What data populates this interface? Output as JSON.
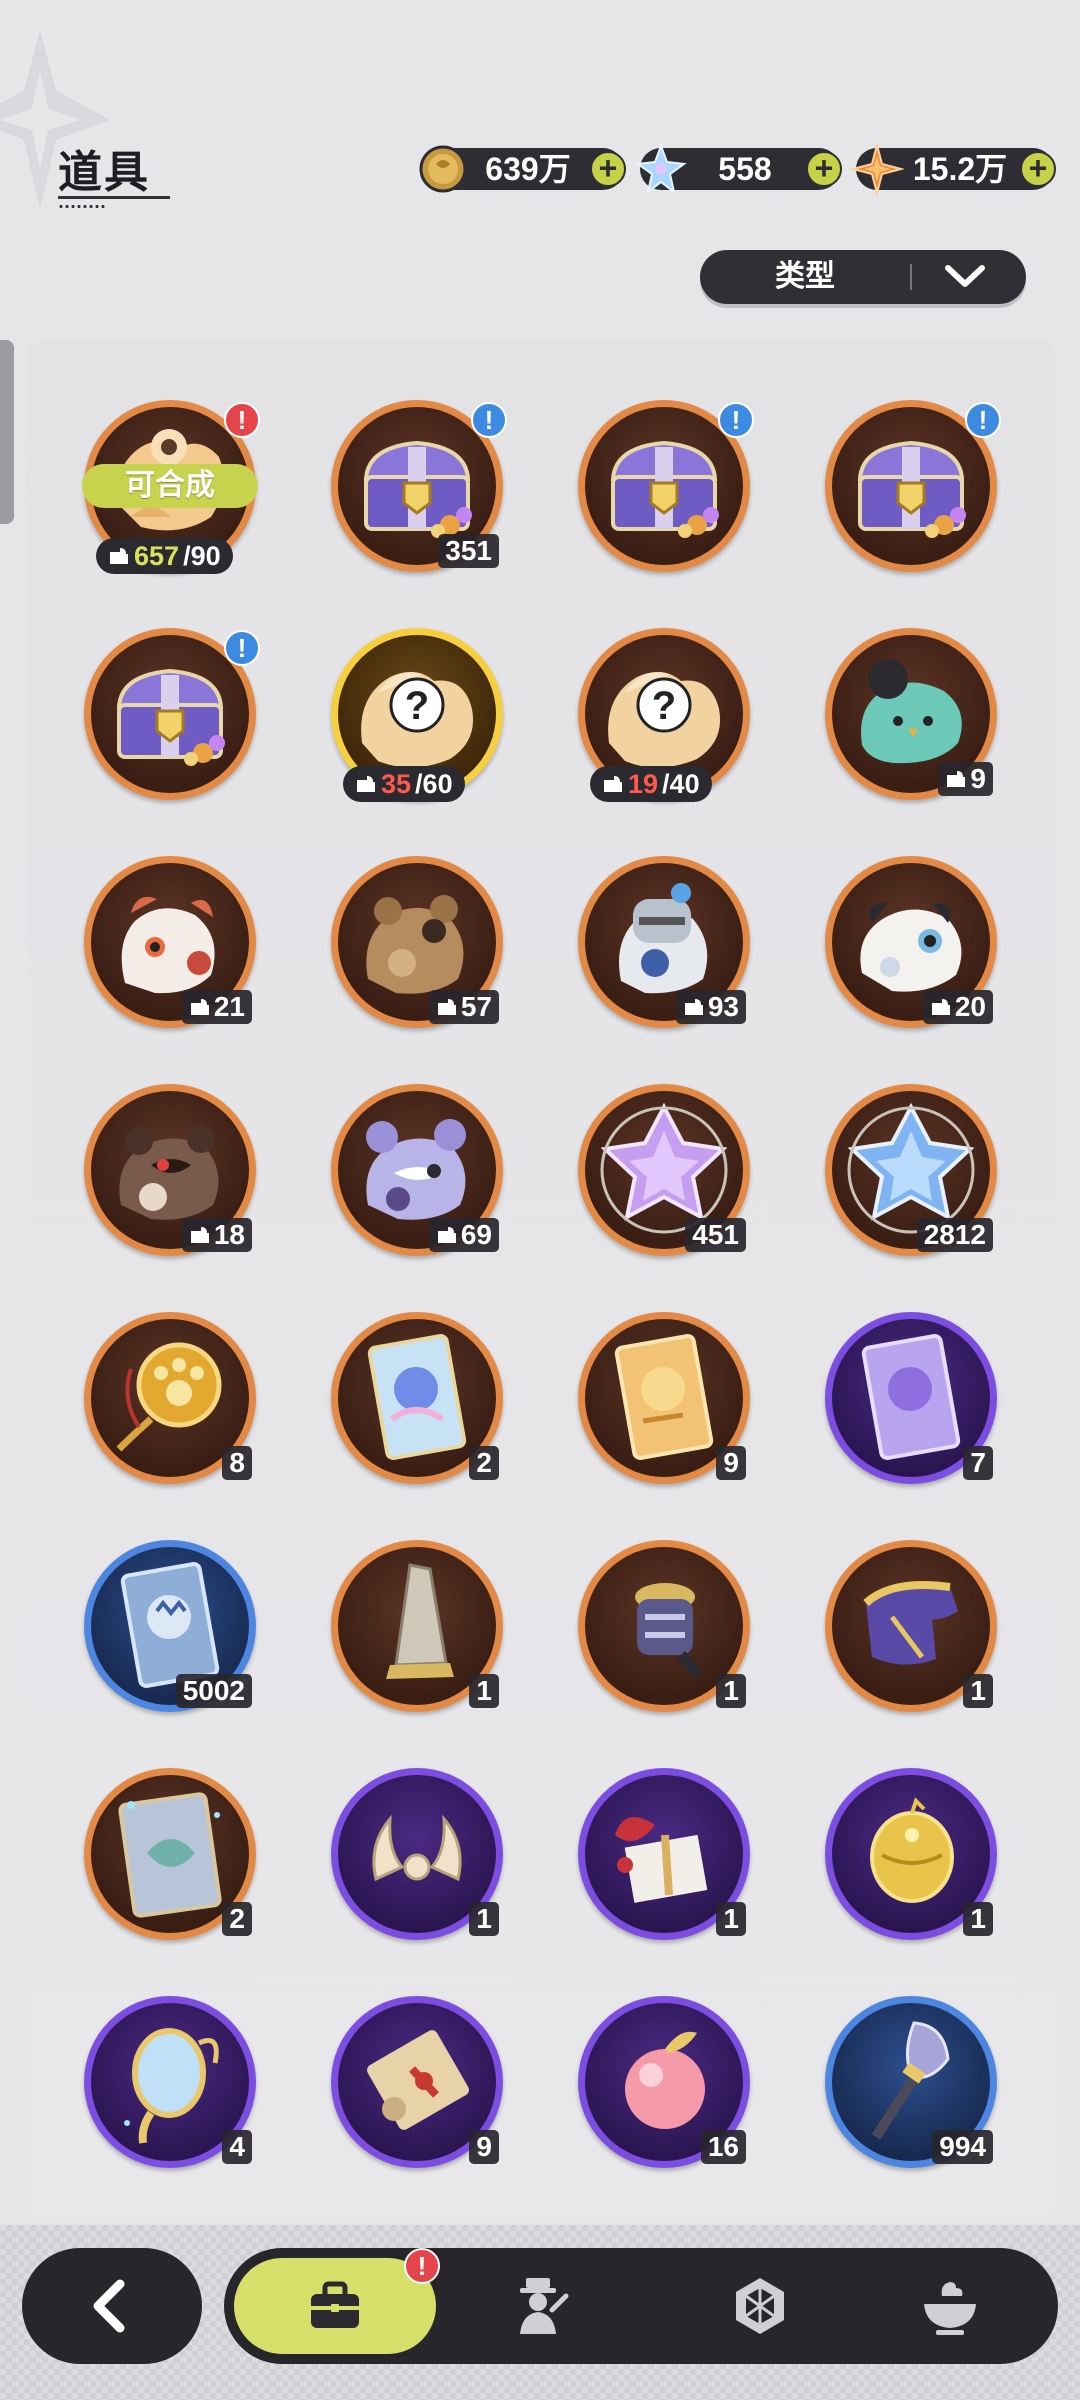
{
  "header": {
    "title": "道具",
    "currencies": [
      {
        "icon": "gold-coin-icon",
        "value": "639万",
        "color": "#d6a94a"
      },
      {
        "icon": "crystal-icon",
        "value": "558",
        "color": "#9fd3ff"
      },
      {
        "icon": "star-shard-icon",
        "value": "15.2万",
        "color": "#f08a3a"
      }
    ],
    "filter": {
      "label": "类型"
    }
  },
  "items": [
    {
      "icon": "fox-fragment-icon",
      "rarity": "orange",
      "combine_label": "可合成",
      "progress_current": "657",
      "progress_total": "/90",
      "progress_state": "ok",
      "alert": "!",
      "alert_color": "red"
    },
    {
      "icon": "treasure-chest-icon",
      "rarity": "orange",
      "count": "351",
      "alert": "!",
      "alert_color": "blue"
    },
    {
      "icon": "treasure-chest-icon",
      "rarity": "orange",
      "count": "",
      "alert": "!",
      "alert_color": "blue"
    },
    {
      "icon": "treasure-chest-icon",
      "rarity": "orange",
      "count": "",
      "alert": "!",
      "alert_color": "blue"
    },
    {
      "icon": "treasure-chest-icon",
      "rarity": "orange",
      "count": "",
      "alert": "!",
      "alert_color": "blue"
    },
    {
      "icon": "mystery-fragment-icon",
      "rarity": "gold",
      "progress_current": "35",
      "progress_total": "/60",
      "progress_state": "low"
    },
    {
      "icon": "mystery-fragment-icon",
      "rarity": "orange",
      "progress_current": "19",
      "progress_total": "/40",
      "progress_state": "low"
    },
    {
      "icon": "bird-fragment-icon",
      "rarity": "orange",
      "count": "9",
      "fragment": true
    },
    {
      "icon": "cat-fragment-icon",
      "rarity": "orange",
      "count": "21",
      "fragment": true
    },
    {
      "icon": "bear-fragment-icon",
      "rarity": "orange",
      "count": "57",
      "fragment": true
    },
    {
      "icon": "knight-fragment-icon",
      "rarity": "orange",
      "count": "93",
      "fragment": true
    },
    {
      "icon": "puppy-fragment-icon",
      "rarity": "orange",
      "count": "20",
      "fragment": true
    },
    {
      "icon": "raccoon-fragment-icon",
      "rarity": "orange",
      "count": "18",
      "fragment": true
    },
    {
      "icon": "mouse-fragment-icon",
      "rarity": "orange",
      "count": "69",
      "fragment": true
    },
    {
      "icon": "purple-crystal-icon",
      "rarity": "orange",
      "count": "451"
    },
    {
      "icon": "blue-crystal-icon",
      "rarity": "orange",
      "count": "2812"
    },
    {
      "icon": "paw-mirror-icon",
      "rarity": "orange",
      "count": "8"
    },
    {
      "icon": "rainbow-card-icon",
      "rarity": "orange",
      "count": "2"
    },
    {
      "icon": "gold-card-icon",
      "rarity": "orange",
      "count": "9"
    },
    {
      "icon": "purple-card-icon",
      "rarity": "purple",
      "count": "7"
    },
    {
      "icon": "blue-card-icon",
      "rarity": "blue",
      "count": "5002"
    },
    {
      "icon": "blade-icon",
      "rarity": "orange",
      "count": "1"
    },
    {
      "icon": "gauntlet-icon",
      "rarity": "orange",
      "count": "1"
    },
    {
      "icon": "boot-icon",
      "rarity": "orange",
      "count": "1"
    },
    {
      "icon": "tarot-card-icon",
      "rarity": "orange",
      "count": "2"
    },
    {
      "icon": "bone-horns-icon",
      "rarity": "purple",
      "count": "1"
    },
    {
      "icon": "gift-box-icon",
      "rarity": "purple",
      "count": "1"
    },
    {
      "icon": "golden-egg-icon",
      "rarity": "purple",
      "count": "1"
    },
    {
      "icon": "hand-mirror-icon",
      "rarity": "purple",
      "count": "4"
    },
    {
      "icon": "scroll-icon",
      "rarity": "purple",
      "count": "9"
    },
    {
      "icon": "peach-icon",
      "rarity": "purple",
      "count": "16"
    },
    {
      "icon": "shovel-icon",
      "rarity": "blue",
      "count": "994"
    }
  ],
  "nav": {
    "back": "back-arrow-icon",
    "tabs": [
      {
        "icon": "bag-icon",
        "active": true,
        "alert": "!"
      },
      {
        "icon": "character-icon"
      },
      {
        "icon": "hexagon-gem-icon"
      },
      {
        "icon": "food-bowl-icon"
      }
    ]
  }
}
